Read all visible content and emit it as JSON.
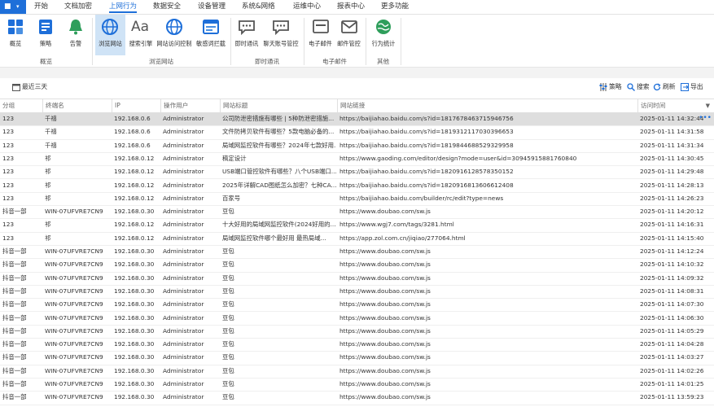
{
  "menu": {
    "items": [
      "开始",
      "文档加密",
      "上网行为",
      "数据安全",
      "设备管理",
      "系统&网络",
      "运维中心",
      "报表中心",
      "更多功能"
    ],
    "active": "上网行为"
  },
  "ribbon": {
    "buttons": [
      "概览",
      "策略",
      "告警",
      "浏览网站",
      "搜索引擎",
      "网站访问控制",
      "敏感词拦截",
      "即时通讯",
      "聊天账号管控",
      "电子邮件",
      "邮件管控",
      "行为统计"
    ],
    "groups": [
      "概览",
      "浏览网站",
      "即时通讯",
      "电子邮件",
      "其他"
    ]
  },
  "toolbar": {
    "date_range": "最近三天",
    "strategy": "策略",
    "search": "搜索",
    "refresh": "刷新",
    "export": "导出"
  },
  "table": {
    "columns": [
      "分组",
      "终端名",
      "IP",
      "操作用户",
      "网站标题",
      "网站链接",
      "访问时间"
    ],
    "rows": [
      [
        "123",
        "千禧",
        "192.168.0.6",
        "Administrator",
        "公司防泄密措施有哪些 | 5种防泄密措施...",
        "https://baijiahao.baidu.com/s?id=1817678463715946756",
        "2025-01-11 14:32:44"
      ],
      [
        "123",
        "千禧",
        "192.168.0.6",
        "Administrator",
        "文件防拷贝软件有哪些？5款电脑必备的...",
        "https://baijiahao.baidu.com/s?id=1819312117030396653",
        "2025-01-11 14:31:58"
      ],
      [
        "123",
        "千禧",
        "192.168.0.6",
        "Administrator",
        "局域网监控软件有哪些？2024年七款好用...",
        "https://baijiahao.baidu.com/s?id=1819844688529329958",
        "2025-01-11 14:31:34"
      ],
      [
        "123",
        "祁",
        "192.168.0.12",
        "Administrator",
        "稿定设计",
        "https://www.gaoding.com/editor/design?mode=user&id=30945915881760840",
        "2025-01-11 14:30:45"
      ],
      [
        "123",
        "祁",
        "192.168.0.12",
        "Administrator",
        "USB端口管控软件有哪些？八个USB端口...",
        "https://baijiahao.baidu.com/s?id=1820916128578350152",
        "2025-01-11 14:29:48"
      ],
      [
        "123",
        "祁",
        "192.168.0.12",
        "Administrator",
        "2025年详解CAD图纸怎么加密？七种CA...",
        "https://baijiahao.baidu.com/s?id=1820916813606612408",
        "2025-01-11 14:28:13"
      ],
      [
        "123",
        "祁",
        "192.168.0.12",
        "Administrator",
        "百家号",
        "https://baijiahao.baidu.com/builder/rc/edit?type=news",
        "2025-01-11 14:26:23"
      ],
      [
        "抖音一部",
        "WIN-07UFVRE7CN9",
        "192.168.0.30",
        "Administrator",
        "豆包",
        "https://www.doubao.com/sw.js",
        "2025-01-11 14:20:12"
      ],
      [
        "123",
        "祁",
        "192.168.0.12",
        "Administrator",
        "十大好用的局域网监控软件(2024好用的...",
        "https://www.wgj7.com/tags/3281.html",
        "2025-01-11 14:16:31"
      ],
      [
        "123",
        "祁",
        "192.168.0.12",
        "Administrator",
        "局域网监控软件哪个最好用 最热局域...",
        "https://app.zol.com.cn/jiqiao/277064.html",
        "2025-01-11 14:15:40"
      ],
      [
        "抖音一部",
        "WIN-07UFVRE7CN9",
        "192.168.0.30",
        "Administrator",
        "豆包",
        "https://www.doubao.com/sw.js",
        "2025-01-11 14:12:24"
      ],
      [
        "抖音一部",
        "WIN-07UFVRE7CN9",
        "192.168.0.30",
        "Administrator",
        "豆包",
        "https://www.doubao.com/sw.js",
        "2025-01-11 14:10:32"
      ],
      [
        "抖音一部",
        "WIN-07UFVRE7CN9",
        "192.168.0.30",
        "Administrator",
        "豆包",
        "https://www.doubao.com/sw.js",
        "2025-01-11 14:09:32"
      ],
      [
        "抖音一部",
        "WIN-07UFVRE7CN9",
        "192.168.0.30",
        "Administrator",
        "豆包",
        "https://www.doubao.com/sw.js",
        "2025-01-11 14:08:31"
      ],
      [
        "抖音一部",
        "WIN-07UFVRE7CN9",
        "192.168.0.30",
        "Administrator",
        "豆包",
        "https://www.doubao.com/sw.js",
        "2025-01-11 14:07:30"
      ],
      [
        "抖音一部",
        "WIN-07UFVRE7CN9",
        "192.168.0.30",
        "Administrator",
        "豆包",
        "https://www.doubao.com/sw.js",
        "2025-01-11 14:06:30"
      ],
      [
        "抖音一部",
        "WIN-07UFVRE7CN9",
        "192.168.0.30",
        "Administrator",
        "豆包",
        "https://www.doubao.com/sw.js",
        "2025-01-11 14:05:29"
      ],
      [
        "抖音一部",
        "WIN-07UFVRE7CN9",
        "192.168.0.30",
        "Administrator",
        "豆包",
        "https://www.doubao.com/sw.js",
        "2025-01-11 14:04:28"
      ],
      [
        "抖音一部",
        "WIN-07UFVRE7CN9",
        "192.168.0.30",
        "Administrator",
        "豆包",
        "https://www.doubao.com/sw.js",
        "2025-01-11 14:03:27"
      ],
      [
        "抖音一部",
        "WIN-07UFVRE7CN9",
        "192.168.0.30",
        "Administrator",
        "豆包",
        "https://www.doubao.com/sw.js",
        "2025-01-11 14:02:26"
      ],
      [
        "抖音一部",
        "WIN-07UFVRE7CN9",
        "192.168.0.30",
        "Administrator",
        "豆包",
        "https://www.doubao.com/sw.js",
        "2025-01-11 14:01:25"
      ],
      [
        "抖音一部",
        "WIN-07UFVRE7CN9",
        "192.168.0.30",
        "Administrator",
        "豆包",
        "https://www.doubao.com/sw.js",
        "2025-01-11 13:59:23"
      ]
    ]
  },
  "colors": {
    "accent": "#1e6fd9",
    "selected_row": "#dedede",
    "active_ribbon_button": "#cfe3f6"
  }
}
